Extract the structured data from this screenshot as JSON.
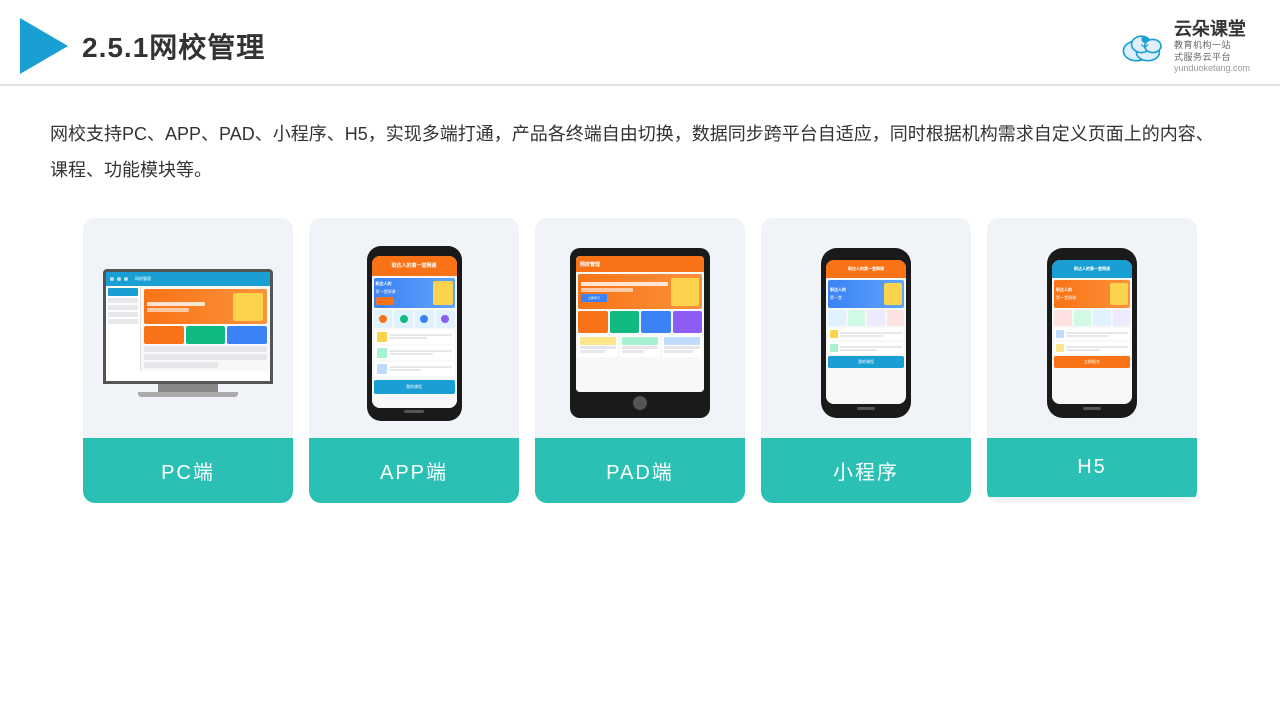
{
  "header": {
    "title": "2.5.1网校管理",
    "brand": {
      "name": "云朵课堂",
      "url": "yunduoketang.com",
      "sub": "教育机构一站\n式服务云平台"
    }
  },
  "description": "网校支持PC、APP、PAD、小程序、H5，实现多端打通，产品各终端自由切换，数据同步跨平台自适应，同时根据机构需求自定义页面上的内容、课程、功能模块等。",
  "cards": [
    {
      "id": "pc",
      "label": "PC端"
    },
    {
      "id": "app",
      "label": "APP端"
    },
    {
      "id": "pad",
      "label": "PAD端"
    },
    {
      "id": "miniprogram",
      "label": "小程序"
    },
    {
      "id": "h5",
      "label": "H5"
    }
  ],
  "colors": {
    "accent_blue": "#1a9fd4",
    "teal": "#2bc0b4",
    "orange": "#f97316"
  }
}
